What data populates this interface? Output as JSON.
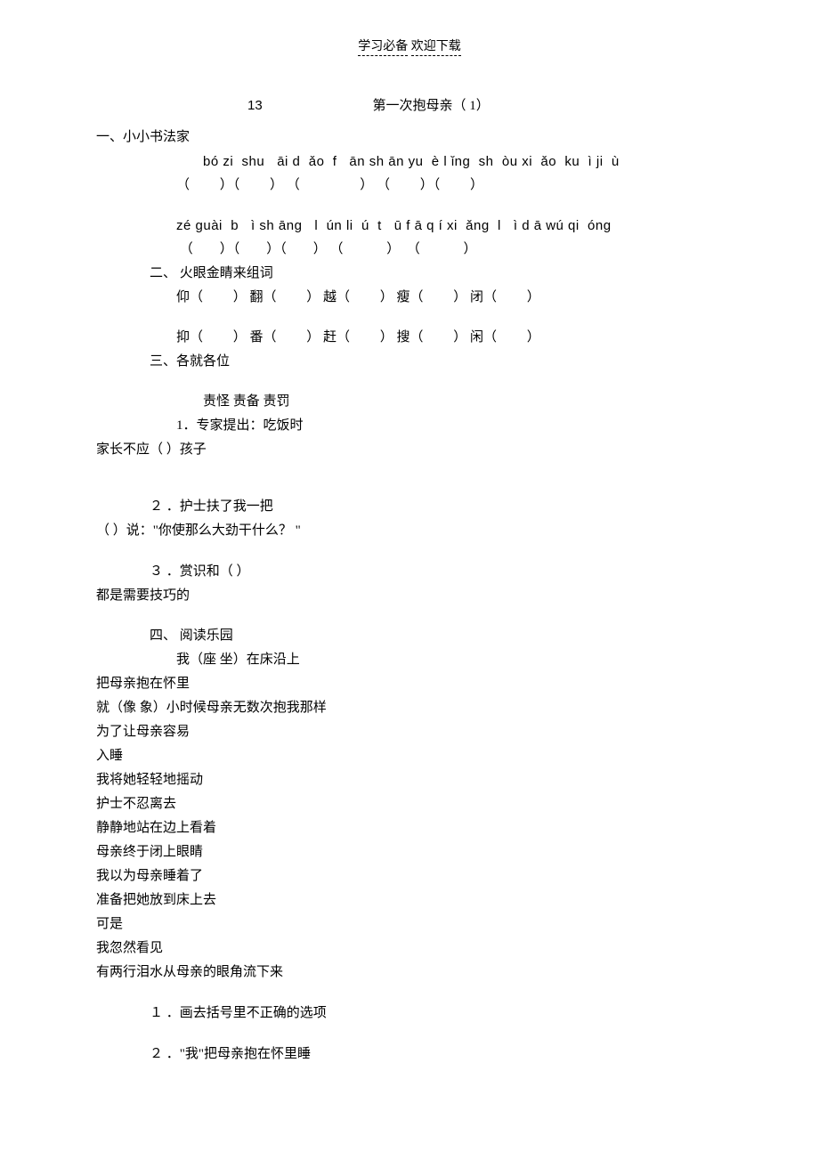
{
  "header": {
    "left": "学习必备",
    "right": "欢迎下载"
  },
  "title": {
    "num": "13",
    "text": "第一次抱母亲（ 1）"
  },
  "sec1": {
    "heading": "一、小小书法家",
    "pinyin1": "bó zi  shu   āi d  ǎo  f   ān sh ān yu  è l ǐng  sh  òu xi  ǎo  ku  ì ji  ù",
    "blanks1": "（         ）（         ） （                  ） （         ）（         ）",
    "pinyin2": "zé ɡuài  b   ì sh ānɡ   l  ún li  ú  t   ū f ā q í xi  ǎnɡ  l   ì d ā wú qi  ónɡ",
    "blanks2": " （        ）（        ）（        ） （             ）  （             ）"
  },
  "sec2": {
    "heading": "二、  火眼金睛来组词",
    "row1": "仰（         ） 翻（         ） 越（         ） 瘦（         ） 闭（         ）",
    "row2": "抑（         ） 番（         ） 赶（         ） 搜（         ） 闲（         ）"
  },
  "sec3": {
    "heading": "三、各就各位",
    "words": "责怪    责备    责罚",
    "q1a": "1．专家提出：吃饭时",
    "q1b": "家长不应（     ）孩子",
    "q2num": "２",
    "q2a": "．护士扶了我一把",
    "q2b": "（     ）说：\"你使那么大劲干什么？    \"",
    "q3num": "３",
    "q3a": "．赏识和（       ）",
    "q3b": "都是需要技巧的"
  },
  "sec4": {
    "heading": "四、  阅读乐园",
    "l0": "我（座    坐）在床沿上",
    "l1": "把母亲抱在怀里",
    "l2": "就（像    象）小时候母亲无数次抱我那样",
    "l3": "为了让母亲容易",
    "l4": "入睡",
    "l5": "我将她轻轻地摇动",
    "l6": "护士不忍离去",
    "l7": "静静地站在边上看着",
    "l8": "母亲终于闭上眼睛",
    "l9": "我以为母亲睡着了",
    "l10": "准备把她放到床上去",
    "l11": "可是",
    "l12": "我忽然看见",
    "l13": "有两行泪水从母亲的眼角流下来",
    "q1num": "１",
    "q1": "．画去括号里不正确的选项",
    "q2num": "２",
    "q2": "．\"我\"把母亲抱在怀里睡"
  }
}
